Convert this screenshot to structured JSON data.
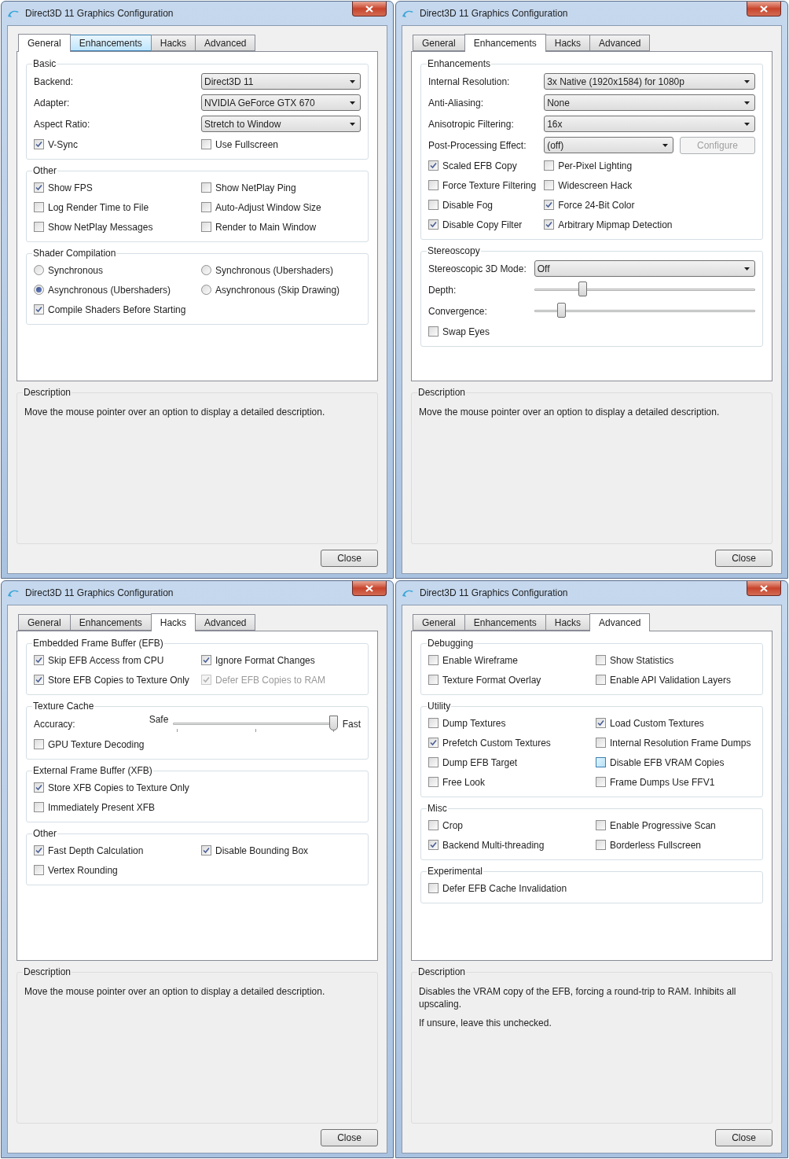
{
  "windows": [
    {
      "title": "Direct3D 11 Graphics Configuration",
      "tabs": [
        {
          "label": "General",
          "selected": true,
          "hovered": false
        },
        {
          "label": "Enhancements",
          "selected": false,
          "hovered": true
        },
        {
          "label": "Hacks",
          "selected": false,
          "hovered": false
        },
        {
          "label": "Advanced",
          "selected": false,
          "hovered": false
        }
      ],
      "groups": [
        {
          "title": "Basic",
          "kind": "grid",
          "rows": [
            [
              {
                "kind": "label",
                "text": "Backend:"
              },
              {
                "kind": "dropdown",
                "value": "Direct3D 11"
              }
            ],
            [
              {
                "kind": "label",
                "text": "Adapter:"
              },
              {
                "kind": "dropdown",
                "value": "NVIDIA GeForce GTX 670"
              }
            ],
            [
              {
                "kind": "label",
                "text": "Aspect Ratio:"
              },
              {
                "kind": "dropdown",
                "value": "Stretch to Window"
              }
            ],
            [
              {
                "kind": "checkbox",
                "label": "V-Sync",
                "checked": true
              },
              {
                "kind": "checkbox",
                "label": "Use Fullscreen",
                "checked": false
              }
            ]
          ]
        },
        {
          "title": "Other",
          "kind": "grid",
          "rows": [
            [
              {
                "kind": "checkbox",
                "label": "Show FPS",
                "checked": true
              },
              {
                "kind": "checkbox",
                "label": "Show NetPlay Ping",
                "checked": false
              }
            ],
            [
              {
                "kind": "checkbox",
                "label": "Log Render Time to File",
                "checked": false
              },
              {
                "kind": "checkbox",
                "label": "Auto-Adjust Window Size",
                "checked": false
              }
            ],
            [
              {
                "kind": "checkbox",
                "label": "Show NetPlay Messages",
                "checked": false
              },
              {
                "kind": "checkbox",
                "label": "Render to Main Window",
                "checked": false
              }
            ]
          ]
        },
        {
          "title": "Shader Compilation",
          "kind": "grid",
          "rows": [
            [
              {
                "kind": "radio",
                "label": "Synchronous",
                "selected": false
              },
              {
                "kind": "radio",
                "label": "Synchronous (Ubershaders)",
                "selected": false
              }
            ],
            [
              {
                "kind": "radio",
                "label": "Asynchronous (Ubershaders)",
                "selected": true
              },
              {
                "kind": "radio",
                "label": "Asynchronous (Skip Drawing)",
                "selected": false
              }
            ],
            [
              {
                "kind": "checkbox",
                "label": "Compile Shaders Before Starting",
                "checked": true
              }
            ]
          ]
        }
      ],
      "description": {
        "title": "Description",
        "paragraphs": [
          "Move the mouse pointer over an option to display a detailed description."
        ]
      },
      "close_button": "Close"
    },
    {
      "title": "Direct3D 11 Graphics Configuration",
      "tabs": [
        {
          "label": "General",
          "selected": false,
          "hovered": false
        },
        {
          "label": "Enhancements",
          "selected": true,
          "hovered": false
        },
        {
          "label": "Hacks",
          "selected": false,
          "hovered": false
        },
        {
          "label": "Advanced",
          "selected": false,
          "hovered": false
        }
      ],
      "groups": [
        {
          "title": "Enhancements",
          "kind": "form",
          "rows": [
            [
              {
                "kind": "label",
                "text": "Internal Resolution:"
              },
              {
                "kind": "dropdown",
                "value": "3x Native (1920x1584) for 1080p"
              }
            ],
            [
              {
                "kind": "label",
                "text": "Anti-Aliasing:"
              },
              {
                "kind": "dropdown",
                "value": "None"
              }
            ],
            [
              {
                "kind": "label",
                "text": "Anisotropic Filtering:"
              },
              {
                "kind": "dropdown",
                "value": "16x"
              }
            ],
            [
              {
                "kind": "label",
                "text": "Post-Processing Effect:"
              },
              {
                "kind": "dropdown",
                "value": "(off)"
              },
              {
                "kind": "button",
                "label": "Configure",
                "disabled": true
              }
            ],
            [
              {
                "kind": "checkbox",
                "label": "Scaled EFB Copy",
                "checked": true
              },
              {
                "kind": "checkbox",
                "label": "Per-Pixel Lighting",
                "checked": false
              }
            ],
            [
              {
                "kind": "checkbox",
                "label": "Force Texture Filtering",
                "checked": false
              },
              {
                "kind": "checkbox",
                "label": "Widescreen Hack",
                "checked": false
              }
            ],
            [
              {
                "kind": "checkbox",
                "label": "Disable Fog",
                "checked": false
              },
              {
                "kind": "checkbox",
                "label": "Force 24-Bit Color",
                "checked": true
              }
            ],
            [
              {
                "kind": "checkbox",
                "label": "Disable Copy Filter",
                "checked": true
              },
              {
                "kind": "checkbox",
                "label": "Arbitrary Mipmap Detection",
                "checked": true
              }
            ]
          ]
        },
        {
          "title": "Stereoscopy",
          "kind": "form",
          "rows": [
            [
              {
                "kind": "label",
                "text": "Stereoscopic 3D Mode:"
              },
              {
                "kind": "dropdown",
                "value": "Off"
              }
            ],
            [
              {
                "kind": "label",
                "text": "Depth:"
              },
              {
                "kind": "slider",
                "level": 0.21
              }
            ],
            [
              {
                "kind": "label",
                "text": "Convergence:"
              },
              {
                "kind": "slider",
                "level": 0.11
              }
            ],
            [
              {
                "kind": "checkbox",
                "label": "Swap Eyes",
                "checked": false
              }
            ]
          ]
        }
      ],
      "description": {
        "title": "Description",
        "paragraphs": [
          "Move the mouse pointer over an option to display a detailed description."
        ]
      },
      "close_button": "Close"
    },
    {
      "title": "Direct3D 11 Graphics Configuration",
      "tabs": [
        {
          "label": "General",
          "selected": false,
          "hovered": false
        },
        {
          "label": "Enhancements",
          "selected": false,
          "hovered": false
        },
        {
          "label": "Hacks",
          "selected": true,
          "hovered": false
        },
        {
          "label": "Advanced",
          "selected": false,
          "hovered": false
        }
      ],
      "groups": [
        {
          "title": "Embedded Frame Buffer (EFB)",
          "kind": "grid",
          "rows": [
            [
              {
                "kind": "checkbox",
                "label": "Skip EFB Access from CPU",
                "checked": true
              },
              {
                "kind": "checkbox",
                "label": "Ignore Format Changes",
                "checked": true
              }
            ],
            [
              {
                "kind": "checkbox",
                "label": "Store EFB Copies to Texture Only",
                "checked": true
              },
              {
                "kind": "checkbox",
                "label": "Defer EFB Copies to RAM",
                "checked": true,
                "disabled": true
              }
            ]
          ]
        },
        {
          "title": "Texture Cache",
          "kind": "form",
          "rows": [
            [
              {
                "kind": "label",
                "text": "Accuracy:"
              },
              {
                "kind": "slider",
                "level": 1,
                "min_label": "Safe",
                "max_label": "Fast",
                "ticks": true
              }
            ],
            [
              {
                "kind": "checkbox",
                "label": "GPU Texture Decoding",
                "checked": false
              }
            ]
          ]
        },
        {
          "title": "External Frame Buffer (XFB)",
          "kind": "grid",
          "rows": [
            [
              {
                "kind": "checkbox",
                "label": "Store XFB Copies to Texture Only",
                "checked": true
              }
            ],
            [
              {
                "kind": "checkbox",
                "label": "Immediately Present XFB",
                "checked": false
              }
            ]
          ]
        },
        {
          "title": "Other",
          "kind": "grid",
          "rows": [
            [
              {
                "kind": "checkbox",
                "label": "Fast Depth Calculation",
                "checked": true
              },
              {
                "kind": "checkbox",
                "label": "Disable Bounding Box",
                "checked": true
              }
            ],
            [
              {
                "kind": "checkbox",
                "label": "Vertex Rounding",
                "checked": false
              }
            ]
          ]
        }
      ],
      "description": {
        "title": "Description",
        "paragraphs": [
          "Move the mouse pointer over an option to display a detailed description."
        ]
      },
      "close_button": "Close"
    },
    {
      "title": "Direct3D 11 Graphics Configuration",
      "tabs": [
        {
          "label": "General",
          "selected": false,
          "hovered": false
        },
        {
          "label": "Enhancements",
          "selected": false,
          "hovered": false
        },
        {
          "label": "Hacks",
          "selected": false,
          "hovered": false
        },
        {
          "label": "Advanced",
          "selected": true,
          "hovered": false
        }
      ],
      "groups": [
        {
          "title": "Debugging",
          "kind": "grid",
          "rows": [
            [
              {
                "kind": "checkbox",
                "label": "Enable Wireframe",
                "checked": false
              },
              {
                "kind": "checkbox",
                "label": "Show Statistics",
                "checked": false
              }
            ],
            [
              {
                "kind": "checkbox",
                "label": "Texture Format Overlay",
                "checked": false
              },
              {
                "kind": "checkbox",
                "label": "Enable API Validation Layers",
                "checked": false
              }
            ]
          ]
        },
        {
          "title": "Utility",
          "kind": "grid",
          "rows": [
            [
              {
                "kind": "checkbox",
                "label": "Dump Textures",
                "checked": false
              },
              {
                "kind": "checkbox",
                "label": "Load Custom Textures",
                "checked": true
              }
            ],
            [
              {
                "kind": "checkbox",
                "label": "Prefetch Custom Textures",
                "checked": true
              },
              {
                "kind": "checkbox",
                "label": "Internal Resolution Frame Dumps",
                "checked": false
              }
            ],
            [
              {
                "kind": "checkbox",
                "label": "Dump EFB Target",
                "checked": false
              },
              {
                "kind": "checkbox",
                "label": "Disable EFB VRAM Copies",
                "checked": false,
                "hovered": true
              }
            ],
            [
              {
                "kind": "checkbox",
                "label": "Free Look",
                "checked": false
              },
              {
                "kind": "checkbox",
                "label": "Frame Dumps Use FFV1",
                "checked": false
              }
            ]
          ]
        },
        {
          "title": "Misc",
          "kind": "grid",
          "rows": [
            [
              {
                "kind": "checkbox",
                "label": "Crop",
                "checked": false
              },
              {
                "kind": "checkbox",
                "label": "Enable Progressive Scan",
                "checked": false
              }
            ],
            [
              {
                "kind": "checkbox",
                "label": "Backend Multi-threading",
                "checked": true
              },
              {
                "kind": "checkbox",
                "label": "Borderless Fullscreen",
                "checked": false
              }
            ]
          ]
        },
        {
          "title": "Experimental",
          "kind": "grid",
          "rows": [
            [
              {
                "kind": "checkbox",
                "label": "Defer EFB Cache Invalidation",
                "checked": false
              }
            ]
          ]
        }
      ],
      "description": {
        "title": "Description",
        "paragraphs": [
          "Disables the VRAM copy of the EFB, forcing a round-trip to RAM. Inhibits all upscaling.",
          "If unsure, leave this unchecked."
        ]
      },
      "close_button": "Close"
    }
  ]
}
